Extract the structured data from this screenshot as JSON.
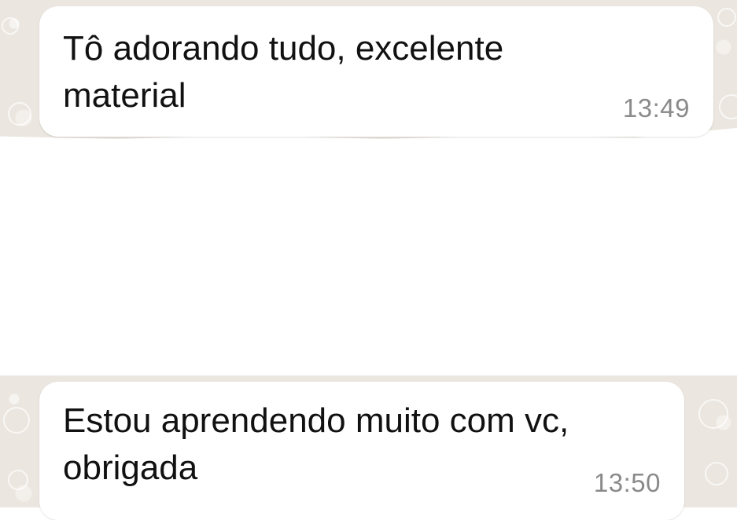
{
  "messages": [
    {
      "text": "Tô adorando tudo, excelente\nmaterial",
      "time": "13:49"
    },
    {
      "text": "Estou aprendendo muito com vc,\nobrigada",
      "time": "13:50"
    }
  ],
  "colors": {
    "chat_background": "#ebe6df",
    "bubble": "#ffffff",
    "message_text": "#111111",
    "timestamp": "#8a8a8a"
  }
}
